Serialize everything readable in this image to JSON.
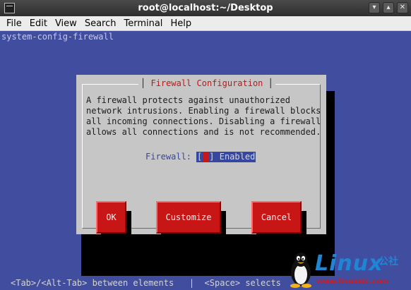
{
  "window": {
    "title": "root@localhost:~/Desktop",
    "minimize_glyph": "▾",
    "maximize_glyph": "▴",
    "close_glyph": "✕"
  },
  "menu": {
    "items": [
      "File",
      "Edit",
      "View",
      "Search",
      "Terminal",
      "Help"
    ]
  },
  "terminal": {
    "command": "system-config-firewall"
  },
  "dialog": {
    "title": "Firewall Configuration",
    "title_bar_left": "│",
    "title_bar_right": "│",
    "message": "A firewall protects against unauthorized\nnetwork intrusions. Enabling a firewall blocks\nall incoming connections. Disabling a firewall\nallows all connections and is not recommended.",
    "firewall_label": "Firewall:",
    "checkbox_open": "[",
    "checkbox_close": "]",
    "firewall_state": "Enabled",
    "buttons": {
      "ok": "OK",
      "customize": "Customize",
      "cancel": "Cancel"
    }
  },
  "status_bar": {
    "text": "<Tab>/<Alt-Tab> between elements   |  <Space> selects"
  },
  "watermark": {
    "brand": "Linux",
    "cn_line1": "公社",
    "url": "www.linuxidc.com"
  },
  "colors": {
    "terminal_bg": "#414d9e",
    "dialog_bg": "#c6c6c6",
    "button_red": "#c81616",
    "title_red": "#c01818"
  }
}
